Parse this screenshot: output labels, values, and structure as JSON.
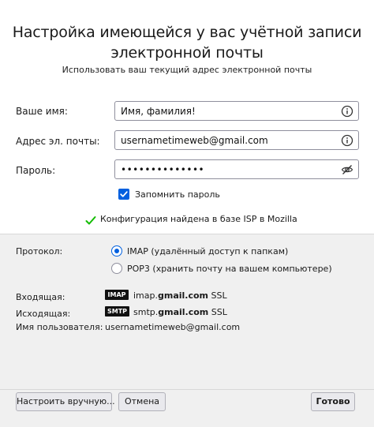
{
  "header": {
    "title_line1": "Настройка имеющейся у вас учётной записи",
    "title_line2": "электронной почты",
    "subtitle": "Использовать ваш текущий адрес электронной почты"
  },
  "form": {
    "name_label": "Ваше имя:",
    "name_value": "Имя, фамилия!",
    "email_label": "Адрес эл. почты:",
    "email_value": "usernametimeweb@gmail.com",
    "password_label": "Пароль:",
    "password_value": "••••••••••••••",
    "remember_label": "Запомнить пароль",
    "remember_checked": true,
    "status_text": "Конфигурация найдена в базе ISP в Mozilla"
  },
  "protocol": {
    "label": "Протокол:",
    "options": [
      {
        "label": "IMAP (удалённый доступ к папкам)",
        "selected": true
      },
      {
        "label": "POP3 (хранить почту на вашем компьютере)",
        "selected": false
      }
    ]
  },
  "servers": {
    "incoming_label": "Входящая:",
    "incoming_tag": "IMAP",
    "incoming_host_prefix": "imap.",
    "incoming_host_bold": "gmail.com",
    "incoming_security": "SSL",
    "outgoing_label": "Исходящая:",
    "outgoing_tag": "SMTP",
    "outgoing_host_prefix": "smtp.",
    "outgoing_host_bold": "gmail.com",
    "outgoing_security": "SSL",
    "username_label": "Имя пользователя:",
    "username_value": "usernametimeweb@gmail.com"
  },
  "buttons": {
    "manual": "Настроить вручную...",
    "cancel": "Отмена",
    "done": "Готово"
  },
  "colors": {
    "accent": "#0060df",
    "success": "#12bc00"
  },
  "icons": {
    "name_info": "info-icon",
    "email_info": "info-icon",
    "password_toggle": "eye-slash-icon",
    "status": "checkmark-icon"
  }
}
